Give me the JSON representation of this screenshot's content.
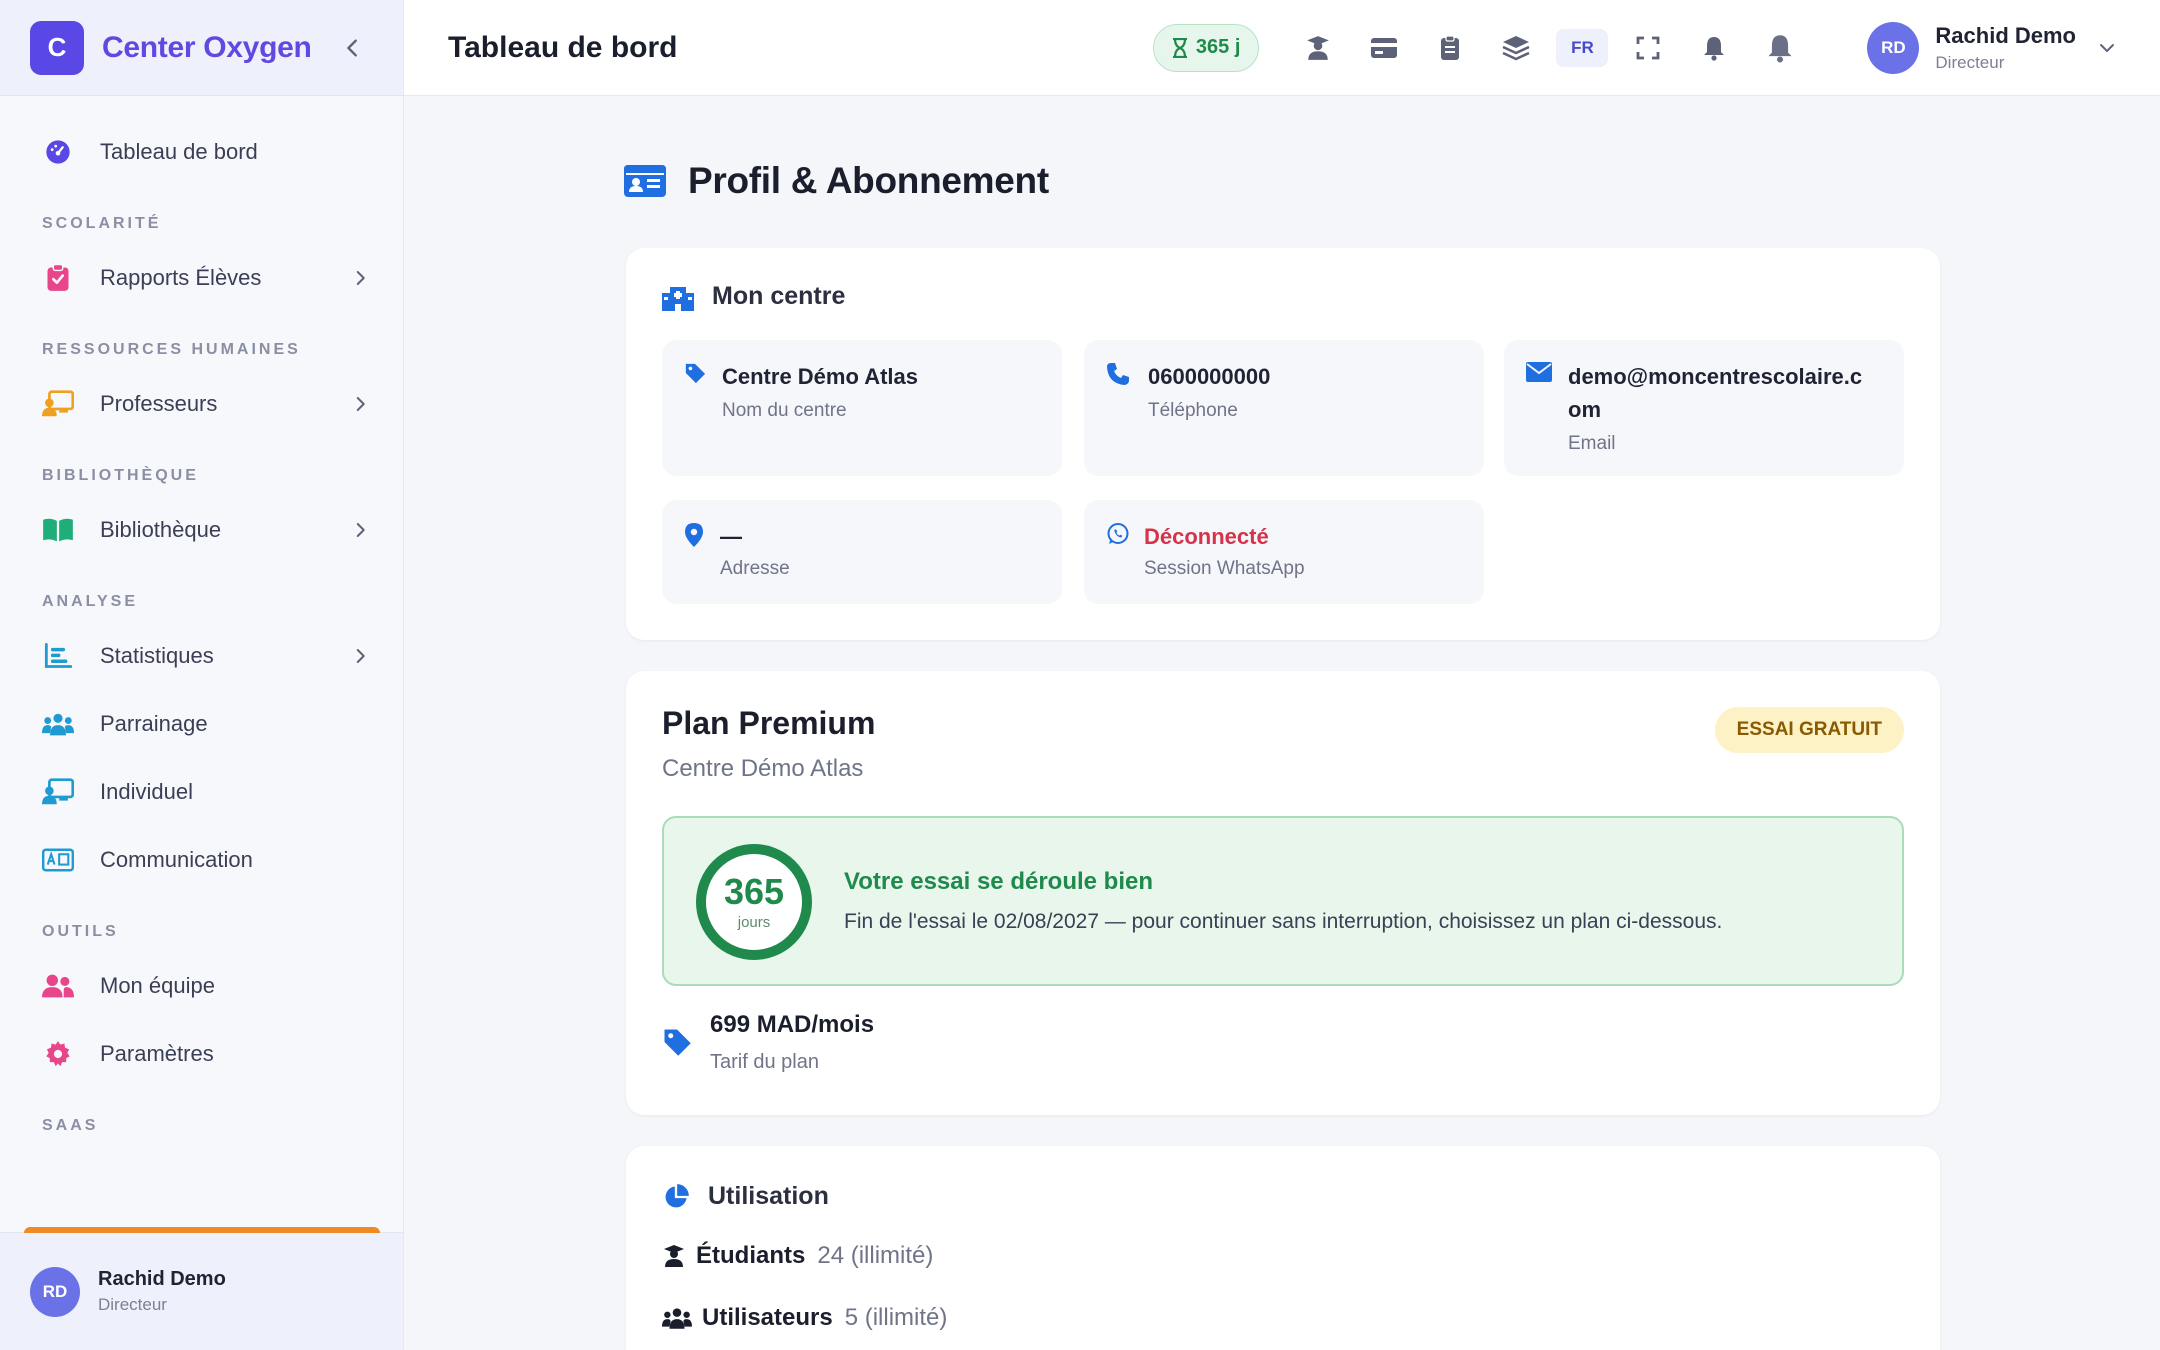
{
  "brand": {
    "logo_letter": "C",
    "name": "Center Oxygen"
  },
  "sidebar": {
    "dashboard": "Tableau de bord",
    "sections": {
      "scolarite": "SCOLARITÉ",
      "rh": "RESSOURCES HUMAINES",
      "bibliotheque": "BIBLIOTHÈQUE",
      "analyse": "ANALYSE",
      "outils": "OUTILS",
      "saas": "SAAS"
    },
    "items": {
      "rapports": "Rapports Élèves",
      "professeurs": "Professeurs",
      "bibliotheque": "Bibliothèque",
      "statistiques": "Statistiques",
      "parrainage": "Parrainage",
      "individuel": "Individuel",
      "communication": "Communication",
      "equipe": "Mon équipe",
      "parametres": "Paramètres"
    },
    "footer_user": {
      "initials": "RD",
      "name": "Rachid Demo",
      "role": "Directeur"
    }
  },
  "topbar": {
    "title": "Tableau de bord",
    "days_badge": "365 j",
    "lang": "FR",
    "user": {
      "initials": "RD",
      "name": "Rachid Demo",
      "role": "Directeur"
    }
  },
  "page": {
    "title": "Profil & Abonnement"
  },
  "centre": {
    "heading": "Mon centre",
    "name_value": "Centre Démo Atlas",
    "name_label": "Nom du centre",
    "phone_value": "0600000000",
    "phone_label": "Téléphone",
    "email_value_1": "demo@moncentrescolaire.c",
    "email_value_2": "om",
    "email_label": "Email",
    "address_value": "—",
    "address_label": "Adresse",
    "whatsapp_value": "Déconnecté",
    "whatsapp_label": "Session WhatsApp"
  },
  "plan": {
    "title": "Plan Premium",
    "subtitle": "Centre Démo Atlas",
    "badge": "ESSAI GRATUIT",
    "days": "365",
    "days_unit": "jours",
    "trial_heading": "Votre essai se déroule bien",
    "trial_text": "Fin de l'essai le 02/08/2027 — pour continuer sans interruption, choisissez un plan ci-dessous.",
    "price": "699 MAD/mois",
    "price_label": "Tarif du plan"
  },
  "usage": {
    "heading": "Utilisation",
    "students_label": "Étudiants",
    "students_value": "24 (illimité)",
    "users_label": "Utilisateurs",
    "users_value": "5 (illimité)"
  },
  "colors": {
    "brand": "#5a48e6",
    "success": "#1f8a4c",
    "danger": "#d6334a",
    "accent_blue": "#1f6fe0"
  }
}
